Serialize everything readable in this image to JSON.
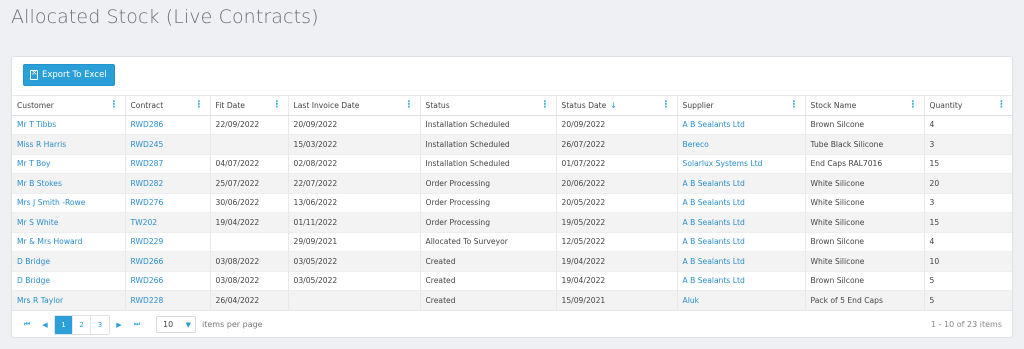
{
  "page": {
    "title": "Allocated Stock (Live Contracts)"
  },
  "toolbar": {
    "export_label": "Export To Excel"
  },
  "columns": [
    {
      "label": "Customer"
    },
    {
      "label": "Contract"
    },
    {
      "label": "Fit Date"
    },
    {
      "label": "Last Invoice Date"
    },
    {
      "label": "Status"
    },
    {
      "label": "Status Date",
      "sorted": "desc"
    },
    {
      "label": "Supplier"
    },
    {
      "label": "Stock Name"
    },
    {
      "label": "Quantity"
    }
  ],
  "rows": [
    {
      "customer": "Mr T Tibbs",
      "contract": "RWD286",
      "fit_date": "22/09/2022",
      "last_invoice_date": "20/09/2022",
      "status": "Installation Scheduled",
      "status_date": "20/09/2022",
      "supplier": "A B Sealants Ltd",
      "stock_name": "Brown Silcone",
      "quantity": "4"
    },
    {
      "customer": "Miss R Harris",
      "contract": "RWD245",
      "fit_date": "",
      "last_invoice_date": "15/03/2022",
      "status": "Installation Scheduled",
      "status_date": "26/07/2022",
      "supplier": "Bereco",
      "stock_name": "Tube Black Silicone",
      "quantity": "3"
    },
    {
      "customer": "Mr T Boy",
      "contract": "RWD287",
      "fit_date": "04/07/2022",
      "last_invoice_date": "02/08/2022",
      "status": "Installation Scheduled",
      "status_date": "01/07/2022",
      "supplier": "Solarlux Systems Ltd",
      "stock_name": "End Caps RAL7016",
      "quantity": "15"
    },
    {
      "customer": "Mr B Stokes",
      "contract": "RWD282",
      "fit_date": "25/07/2022",
      "last_invoice_date": "22/07/2022",
      "status": "Order Processing",
      "status_date": "20/06/2022",
      "supplier": "A B Sealants Ltd",
      "stock_name": "White Silicone",
      "quantity": "20"
    },
    {
      "customer": "Mrs J Smith -Rowe",
      "contract": "RWD276",
      "fit_date": "30/06/2022",
      "last_invoice_date": "13/06/2022",
      "status": "Order Processing",
      "status_date": "20/05/2022",
      "supplier": "A B Sealants Ltd",
      "stock_name": "White Silicone",
      "quantity": "3"
    },
    {
      "customer": "Mr S White",
      "contract": "TW202",
      "fit_date": "19/04/2022",
      "last_invoice_date": "01/11/2022",
      "status": "Order Processing",
      "status_date": "19/05/2022",
      "supplier": "A B Sealants Ltd",
      "stock_name": "White Silicone",
      "quantity": "15"
    },
    {
      "customer": "Mr & Mrs Howard",
      "contract": "RWD229",
      "fit_date": "",
      "last_invoice_date": "29/09/2021",
      "status": "Allocated To Surveyor",
      "status_date": "12/05/2022",
      "supplier": "A B Sealants Ltd",
      "stock_name": "Brown Silcone",
      "quantity": "4"
    },
    {
      "customer": "D Bridge",
      "contract": "RWD266",
      "fit_date": "03/08/2022",
      "last_invoice_date": "03/05/2022",
      "status": "Created",
      "status_date": "19/04/2022",
      "supplier": "A B Sealants Ltd",
      "stock_name": "White Silicone",
      "quantity": "10"
    },
    {
      "customer": "D Bridge",
      "contract": "RWD266",
      "fit_date": "03/08/2022",
      "last_invoice_date": "03/05/2022",
      "status": "Created",
      "status_date": "19/04/2022",
      "supplier": "A B Sealants Ltd",
      "stock_name": "Brown Silcone",
      "quantity": "5"
    },
    {
      "customer": "Mrs R Taylor",
      "contract": "RWD228",
      "fit_date": "26/04/2022",
      "last_invoice_date": "",
      "status": "Created",
      "status_date": "15/09/2021",
      "supplier": "Aluk",
      "stock_name": "Pack of 5 End Caps",
      "quantity": "5"
    }
  ],
  "pager": {
    "pages": [
      "1",
      "2",
      "3"
    ],
    "current_page": "1",
    "page_size": "10",
    "items_per_page_label": "items per page",
    "range_text": "1 - 10 of 23 items"
  },
  "colors": {
    "accent": "#2ba0d8",
    "link": "#2a8fcc"
  }
}
